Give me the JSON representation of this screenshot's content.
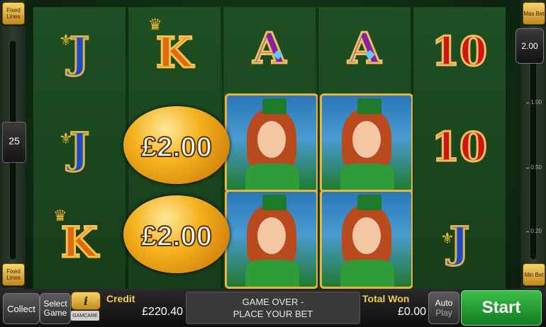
{
  "left_rail": {
    "fixed_lines_top": "Fixed Lines",
    "lines_value": "25",
    "fixed_lines_bottom": "Fixed Lines"
  },
  "right_rail": {
    "max_bet": "Max Bet",
    "stake_value": "2.00",
    "ticks": [
      "1.00",
      "0.50",
      "0.20"
    ],
    "min_bet": "Min Bet"
  },
  "reels": {
    "reel1": [
      "J",
      "J",
      "K"
    ],
    "reel2": [
      "K"
    ],
    "reel3": [
      "A"
    ],
    "reel4": [
      "A"
    ],
    "reel5": [
      "10",
      "10",
      "J"
    ],
    "pot_values": [
      "£2.00",
      "£2.00"
    ]
  },
  "bottom_bar": {
    "collect": "Collect",
    "select_game": "Select Game",
    "info_icon": "i",
    "gamcare": "GAMCARE",
    "credit_label": "Credit",
    "credit_value": "£220.40",
    "message_line1": "GAME OVER -",
    "message_line2": "PLACE YOUR BET",
    "total_won_label": "Total Won",
    "total_won_value": "£0.00",
    "auto_play_line1": "Auto",
    "auto_play_line2": "Play",
    "start": "Start"
  },
  "colors": {
    "start_green": "#2aa83a",
    "gold_label": "#f5d04a",
    "background_green": "#1f4a24"
  }
}
